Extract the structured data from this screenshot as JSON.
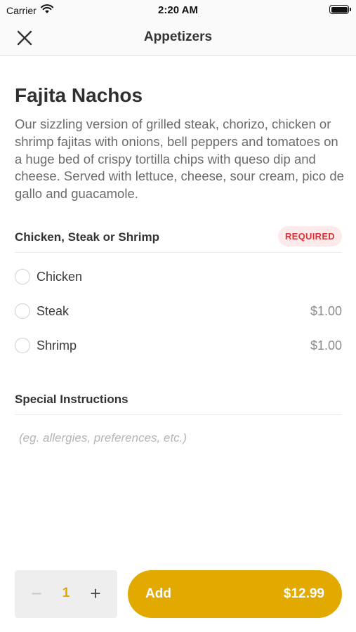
{
  "status_bar": {
    "carrier": "Carrier",
    "time": "2:20 AM",
    "icons": [
      "wifi-icon",
      "battery-icon"
    ]
  },
  "nav": {
    "title": "Appetizers",
    "close_icon": "close-icon"
  },
  "item": {
    "name": "Fajita Nachos",
    "description": "Our sizzling version of grilled steak, chorizo, chicken or shrimp fajitas with onions, bell peppers and tomatoes on a huge bed of crispy tortilla chips with queso dip and cheese. Served with lettuce, cheese, sour cream, pico de gallo and guacamole."
  },
  "option_group": {
    "title": "Chicken, Steak or Shrimp",
    "badge": "REQUIRED",
    "options": [
      {
        "label": "Chicken",
        "price": ""
      },
      {
        "label": "Steak",
        "price": "$1.00"
      },
      {
        "label": "Shrimp",
        "price": "$1.00"
      }
    ]
  },
  "special_instructions": {
    "title": "Special Instructions",
    "value": "",
    "placeholder": "(eg. allergies, preferences, etc.)"
  },
  "footer": {
    "minus": "−",
    "quantity": "1",
    "plus": "+",
    "add_label": "Add",
    "total": "$12.99"
  },
  "colors": {
    "accent": "#e2a900",
    "required_text": "#d9343a",
    "required_bg": "#fdeaea"
  }
}
